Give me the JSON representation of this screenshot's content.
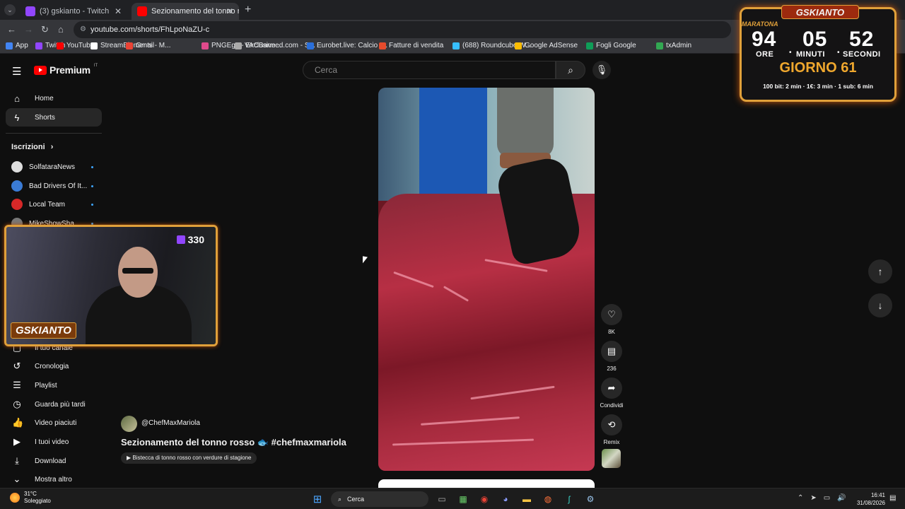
{
  "browser": {
    "tabs": [
      {
        "label": "(3) gskianto - Twitch",
        "favicon_color": "#9146ff"
      },
      {
        "label": "Sezionamento del tonno ro",
        "favicon_color": "#ff0000"
      }
    ],
    "url": "youtube.com/shorts/FhLpoNaZU-c",
    "bookmarks": [
      {
        "label": "App",
        "color": "#4285f4"
      },
      {
        "label": "Twitch",
        "color": "#9146ff"
      },
      {
        "label": "YouTube",
        "color": "#ff0000"
      },
      {
        "label": "StreamElements - M...",
        "color": "#ffffff"
      },
      {
        "label": "Gmail",
        "color": "#ea4335"
      },
      {
        "label": "PNGEgg - Exclusive...",
        "color": "#e04a8c"
      },
      {
        "label": "VACBanned.com - S...",
        "color": "#aaaaaa"
      },
      {
        "label": "Eurobet.live: Calcio r...",
        "color": "#2a6fdb"
      },
      {
        "label": "Fatture di vendita",
        "color": "#e54b2c"
      },
      {
        "label": "(688) Roundcube W...",
        "color": "#37beff"
      },
      {
        "label": "Google AdSense",
        "color": "#fbbc04"
      },
      {
        "label": "Fogli Google",
        "color": "#0f9d58"
      },
      {
        "label": "txAdmin",
        "color": "#32a852"
      }
    ]
  },
  "youtube": {
    "brand": "Premium",
    "brand_sup": "IT",
    "search_placeholder": "Cerca",
    "sidebar": {
      "items": [
        {
          "label": "Home",
          "icon": "home-icon",
          "glyph": "⌂"
        },
        {
          "label": "Shorts",
          "icon": "shorts-icon",
          "glyph": "ϟ"
        }
      ],
      "subs_title": "Iscrizioni",
      "subscriptions": [
        {
          "label": "SolfataraNews",
          "color": "#dddddd"
        },
        {
          "label": "Bad Drivers Of It...",
          "color": "#3a7bd5"
        },
        {
          "label": "Local Team",
          "color": "#d62828"
        },
        {
          "label": "MikeShowSha",
          "color": "#777777"
        }
      ],
      "you_items": [
        {
          "label": "Il tuo canale",
          "icon": "channel-icon",
          "glyph": "▢"
        },
        {
          "label": "Cronologia",
          "icon": "history-icon",
          "glyph": "↺"
        },
        {
          "label": "Playlist",
          "icon": "playlist-icon",
          "glyph": "☰"
        },
        {
          "label": "Guarda più tardi",
          "icon": "watch-later-icon",
          "glyph": "◷"
        },
        {
          "label": "Video piaciuti",
          "icon": "liked-videos-icon",
          "glyph": "👍"
        },
        {
          "label": "I tuoi video",
          "icon": "your-videos-icon",
          "glyph": "▶"
        },
        {
          "label": "Download",
          "icon": "download-icon",
          "glyph": "⤓"
        },
        {
          "label": "Mostra altro",
          "icon": "chevron-down-icon",
          "glyph": "⌄"
        }
      ]
    },
    "short": {
      "channel": "@ChefMaxMariola",
      "title": "Sezionamento del tonno rosso 🐟 #chefmaxmariola",
      "tag": "▶ Bistecca di tonno rosso con verdure di stagione",
      "likes": "8K",
      "comments": "236",
      "share_label": "Condividi",
      "remix_label": "Remix"
    }
  },
  "stream_overlay": {
    "viewers": "330",
    "badge": "GSKIANTO",
    "timer_title": "GSKIANTO",
    "timer_sub": "MARATONA",
    "hours": "94",
    "minutes": "05",
    "seconds": "52",
    "hours_label": "ORE",
    "minutes_label": "MINUTI",
    "seconds_label": "SECONDI",
    "day": "GIORNO 61",
    "rates": "100 bit: 2 min · 1€: 3 min · 1 sub: 6 min"
  },
  "taskbar": {
    "temp": "31°C",
    "weather": "Soleggiato",
    "search": "Cerca",
    "time": "16:41",
    "date": "31/08/2026"
  }
}
